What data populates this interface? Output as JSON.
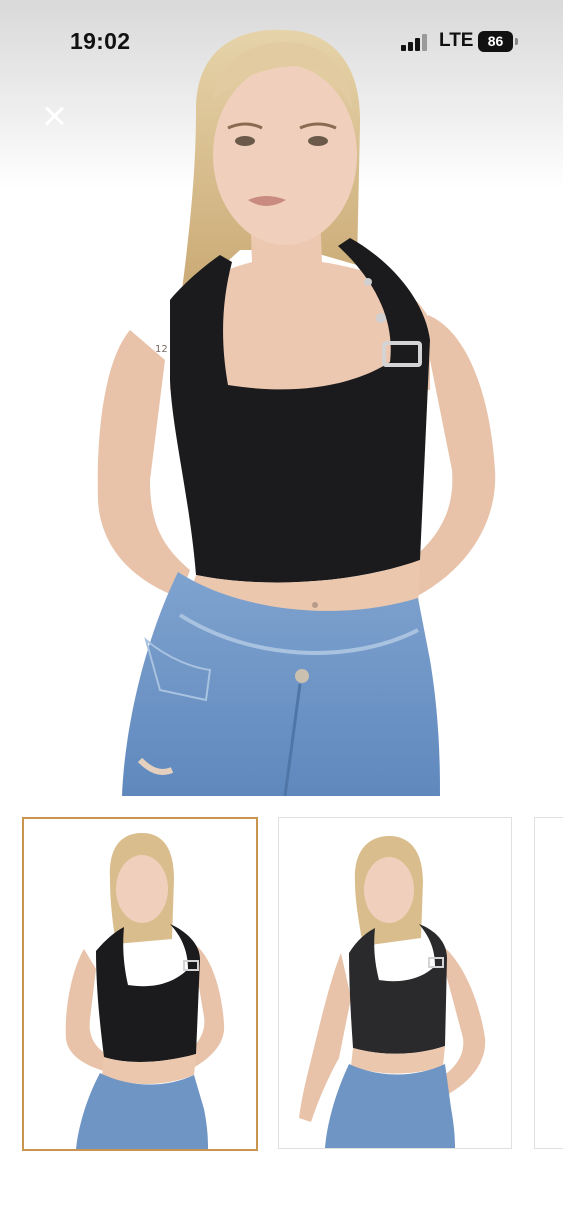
{
  "status_bar": {
    "time": "19:02",
    "network": "LTE",
    "battery_level": "86",
    "signal_bars": 4
  },
  "viewer": {
    "close_icon": "close-icon",
    "main_image": {
      "description_icon": "product-photo"
    }
  },
  "thumbnails": {
    "selected_index": 0,
    "items": [
      {
        "pose": "hands-behind-back",
        "selected": true
      },
      {
        "pose": "hands-on-hips",
        "selected": false
      },
      {
        "pose": "partial",
        "selected": false
      }
    ]
  },
  "colors": {
    "selected_border": "#c8944f",
    "top": "#1a1a1c",
    "jeans": "#6f95c4",
    "skin": "#eac5ad",
    "hair": "#d9bd8c"
  }
}
